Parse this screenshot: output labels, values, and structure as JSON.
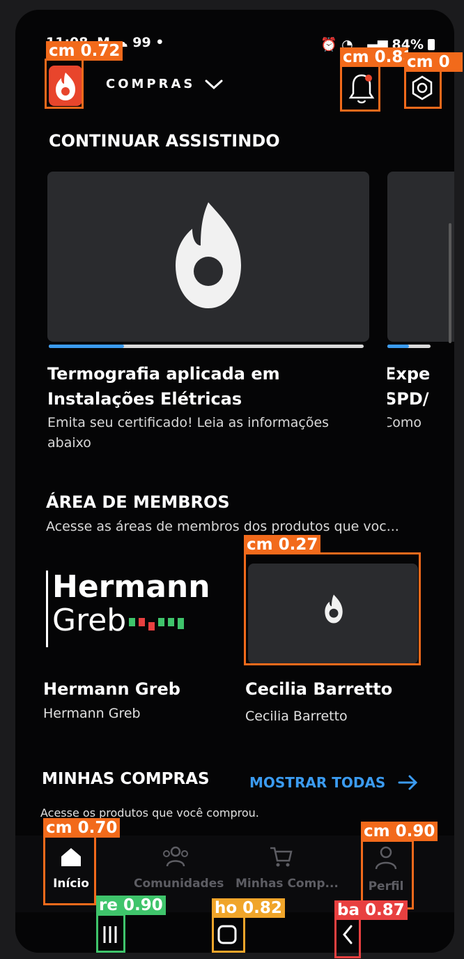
{
  "status_bar": {
    "time": "11:08",
    "indicators": "M ☁ 99 •",
    "right": "84%"
  },
  "app_bar": {
    "title": "COMPRAS"
  },
  "continue_watching": {
    "title": "CONTINUAR ASSISTINDO",
    "cards": [
      {
        "title": "Termografia aplicada em Instalações Elétricas",
        "title_line1": "Termografia aplicada em",
        "title_line2": "Instalações Elétricas",
        "desc_line1": "Emita seu certificado! Leia as informações",
        "desc_line2": "abaixo",
        "progress": 0.24
      },
      {
        "title_line1": "Expe",
        "title_line2": "SPD/",
        "desc_line1": "Como",
        "progress": 0.5
      }
    ]
  },
  "members_area": {
    "title": "ÁREA DE MEMBROS",
    "subtitle": "Acesse as áreas de membros dos produtos que voc...",
    "items": [
      {
        "logo_line1": "Hermann",
        "logo_line2": "Greb",
        "name": "Hermann Greb",
        "subtitle": "Hermann Greb"
      },
      {
        "name": "Cecilia Barretto",
        "subtitle": "Cecilia Barretto"
      }
    ]
  },
  "my_purchases": {
    "title": "MINHAS COMPRAS",
    "show_all": "MOSTRAR TODAS",
    "subtitle": "Acesse os produtos que você comprou."
  },
  "bottom_nav": [
    {
      "label": "Início",
      "icon": "home-icon",
      "active": true
    },
    {
      "label": "Comunidades",
      "icon": "people-icon"
    },
    {
      "label": "Minhas Comp...",
      "icon": "cart-icon"
    },
    {
      "label": "Perfil",
      "icon": "person-icon"
    }
  ],
  "detections": [
    {
      "label": "cm 0.72"
    },
    {
      "label": "cm 0.88"
    },
    {
      "label": "cm 0"
    },
    {
      "label": "cm 0.27"
    },
    {
      "label": "cm 0.70"
    },
    {
      "label": "cm 0.90"
    },
    {
      "label": "re 0.90"
    },
    {
      "label": "ho 0.82"
    },
    {
      "label": "ba 0.87"
    }
  ],
  "colors": {
    "accent_orange": "#f26a1b",
    "brand_red": "#e8452c",
    "link_blue": "#3b9bf0",
    "recents_green": "#3fc46b",
    "home_yellow": "#f0a52a",
    "back_red": "#e84040"
  }
}
